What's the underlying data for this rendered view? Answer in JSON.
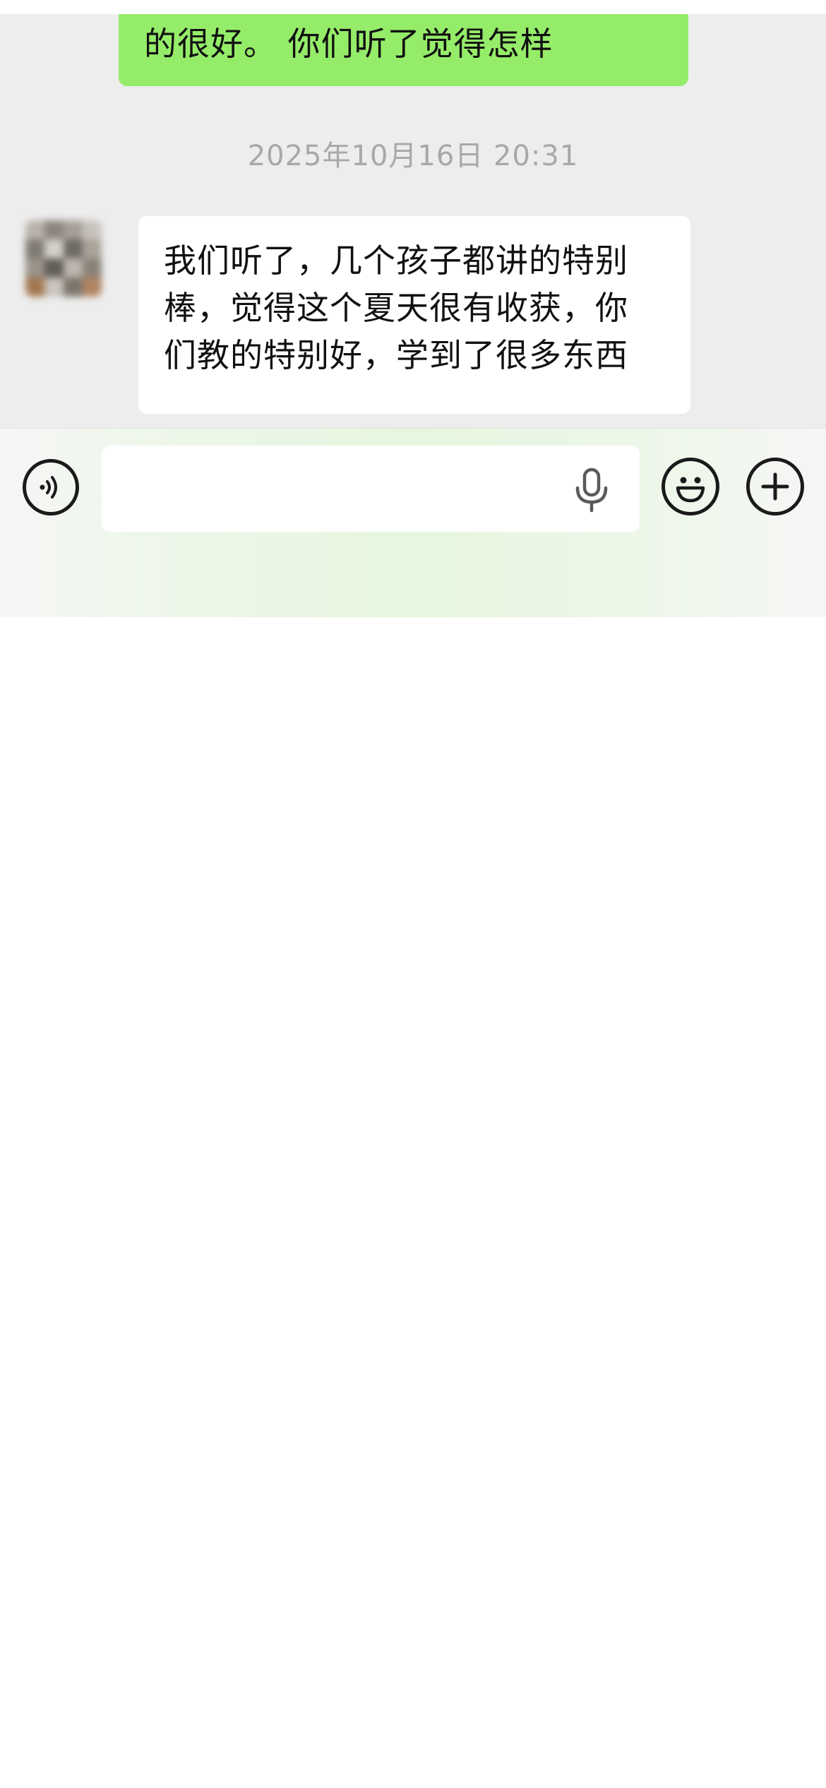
{
  "chat": {
    "outgoing_message": {
      "visible_text": "的很好。 你们听了觉得怎样"
    },
    "timestamp": "2025年10月16日 20:31",
    "incoming_message": {
      "lines": [
        "我们听了，几个孩子都讲的特别",
        "棒，觉得这个夏天很有收获，你",
        "们教的特别好，学到了很多东西"
      ]
    }
  },
  "input_bar": {
    "voice_icon": "voice-input-icon",
    "text_value": "",
    "mic_icon": "microphone-icon",
    "emoji_icon": "emoji-face-icon",
    "plus_icon": "plus-icon"
  },
  "colors": {
    "chat_background": "#ededed",
    "outgoing_bubble": "#95ec69",
    "incoming_bubble": "#ffffff",
    "timestamp_text": "#a8a8a8",
    "icon_stroke": "#1a1a1a"
  }
}
